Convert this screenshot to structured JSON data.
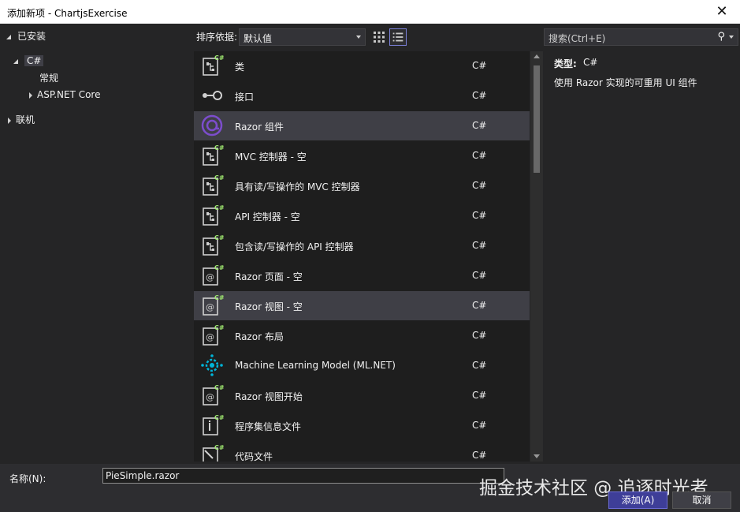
{
  "window": {
    "title": "添加新项 - ChartjsExercise",
    "close_glyph": "✕"
  },
  "tree": {
    "installed": "已安装",
    "csharp": "C#",
    "general": "常规",
    "aspnet": "ASP.NET Core",
    "online": "联机"
  },
  "toolbar": {
    "sort_label": "排序依据:",
    "sort_value": "默认值"
  },
  "search": {
    "placeholder": "搜索(Ctrl+E)",
    "icon": "⚲"
  },
  "templates": [
    {
      "name": "类",
      "lang": "C#",
      "icon": "class-icon"
    },
    {
      "name": "接口",
      "lang": "C#",
      "icon": "interface-icon"
    },
    {
      "name": "Razor 组件",
      "lang": "C#",
      "icon": "razor-component-icon",
      "selected": true
    },
    {
      "name": "MVC 控制器 - 空",
      "lang": "C#",
      "icon": "class-icon"
    },
    {
      "name": "具有读/写操作的 MVC 控制器",
      "lang": "C#",
      "icon": "class-icon"
    },
    {
      "name": "API 控制器 - 空",
      "lang": "C#",
      "icon": "class-icon"
    },
    {
      "name": "包含读/写操作的 API 控制器",
      "lang": "C#",
      "icon": "class-icon"
    },
    {
      "name": "Razor 页面 - 空",
      "lang": "C#",
      "icon": "razor-page-icon"
    },
    {
      "name": "Razor 视图 - 空",
      "lang": "C#",
      "icon": "razor-page-icon",
      "hover": true
    },
    {
      "name": "Razor 布局",
      "lang": "C#",
      "icon": "razor-page-icon"
    },
    {
      "name": "Machine Learning Model (ML.NET)",
      "lang": "C#",
      "icon": "ml-icon"
    },
    {
      "name": "Razor 视图开始",
      "lang": "C#",
      "icon": "razor-page-icon"
    },
    {
      "name": "程序集信息文件",
      "lang": "C#",
      "icon": "info-file-icon"
    },
    {
      "name": "代码文件",
      "lang": "C#",
      "icon": "code-file-icon"
    }
  ],
  "details": {
    "type_label": "类型:",
    "type_value": "C#",
    "description": "使用 Razor 实现的可重用 UI 组件"
  },
  "bottom": {
    "name_label": "名称(N):",
    "name_value": "PieSimple.razor",
    "watermark": "掘金技术社区 @ 追逐时光者",
    "add_label": "添加(A)",
    "cancel_label": "取消"
  },
  "colors": {
    "accent": "#3e3e98",
    "csharp_badge": "#68217a",
    "razor": "#5c2d91",
    "ml": "#00b4d8"
  }
}
